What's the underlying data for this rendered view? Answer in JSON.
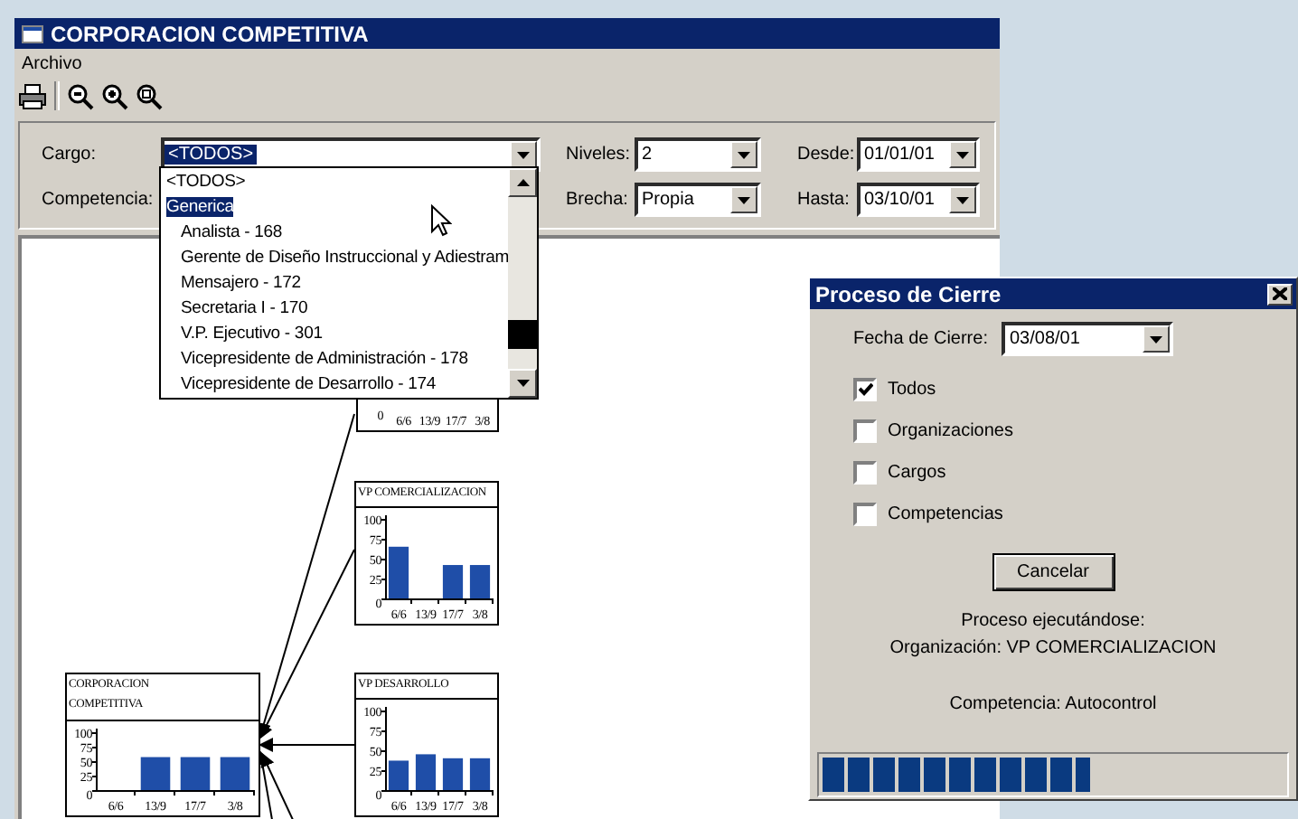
{
  "window": {
    "title": "CORPORACION COMPETITIVA"
  },
  "menu": [
    {
      "label": "Archivo"
    }
  ],
  "filters": {
    "cargo": {
      "label": "Cargo:",
      "value": "<TODOS>"
    },
    "niveles": {
      "label": "Niveles:",
      "value": "2"
    },
    "desde": {
      "label": "Desde:",
      "value": "01/01/01"
    },
    "competencia": {
      "label": "Competencia:"
    },
    "brecha": {
      "label": "Brecha:",
      "value": "Propia"
    },
    "hasta": {
      "label": "Hasta:",
      "value": "03/10/01"
    }
  },
  "dropdown": {
    "items": [
      {
        "label": "<TODOS>",
        "selected": false
      },
      {
        "label": "Generica",
        "selected": true,
        "children": [
          {
            "label": "Analista - 168",
            "selected": false
          },
          {
            "label": "Gerente de Diseño Instruccional y Adiestram",
            "selected": false
          },
          {
            "label": "Mensajero - 172",
            "selected": false
          },
          {
            "label": "Secretaria I - 170",
            "selected": false
          },
          {
            "label": "V.P. Ejecutivo - 301",
            "selected": false
          },
          {
            "label": "Vicepresidente de Administración - 178",
            "selected": false
          },
          {
            "label": "Vicepresidente de Desarrollo - 174",
            "selected": false
          }
        ]
      }
    ]
  },
  "diagram": {
    "nodes": [
      {
        "kind": "partial",
        "x_labels": [
          "6/6",
          "13/9",
          "17/7",
          "3/8"
        ],
        "y_label": "0"
      },
      {
        "kind": "chart",
        "title": "VP COMERCIALIZACION",
        "chart_data": {
          "type": "bar",
          "categories": [
            "6/6",
            "13/9",
            "17/7",
            "3/8"
          ],
          "values": [
            65,
            null,
            42,
            42
          ],
          "ylim": [
            0,
            100
          ],
          "yticks": [
            0,
            25,
            50,
            75,
            100
          ]
        }
      },
      {
        "kind": "chart",
        "title": "CORPORACION COMPETITIVA",
        "chart_data": {
          "type": "bar",
          "categories": [
            "6/6",
            "13/9",
            "17/7",
            "3/8"
          ],
          "values": [
            null,
            57,
            57,
            57
          ],
          "ylim": [
            0,
            100
          ],
          "yticks": [
            0,
            25,
            50,
            75,
            100
          ]
        }
      },
      {
        "kind": "chart",
        "title": "VP DESARROLLO",
        "chart_data": {
          "type": "bar",
          "categories": [
            "6/6",
            "13/9",
            "17/7",
            "3/8"
          ],
          "values": [
            37,
            45,
            40,
            40
          ],
          "ylim": [
            0,
            100
          ],
          "yticks": [
            0,
            25,
            50,
            75,
            100
          ]
        }
      }
    ]
  },
  "dialog": {
    "title": "Proceso de Cierre",
    "date": {
      "label": "Fecha de Cierre:",
      "value": "03/08/01"
    },
    "options": [
      {
        "label": "Todos",
        "checked": true
      },
      {
        "label": "Organizaciones",
        "checked": false
      },
      {
        "label": "Cargos",
        "checked": false
      },
      {
        "label": "Competencias",
        "checked": false
      }
    ],
    "button": "Cancelar",
    "status": [
      "Proceso ejecutándose:",
      "Organización: VP COMERCIALIZACION",
      "Competencia: Autocontrol"
    ],
    "progress": {
      "level": 0.58
    }
  }
}
